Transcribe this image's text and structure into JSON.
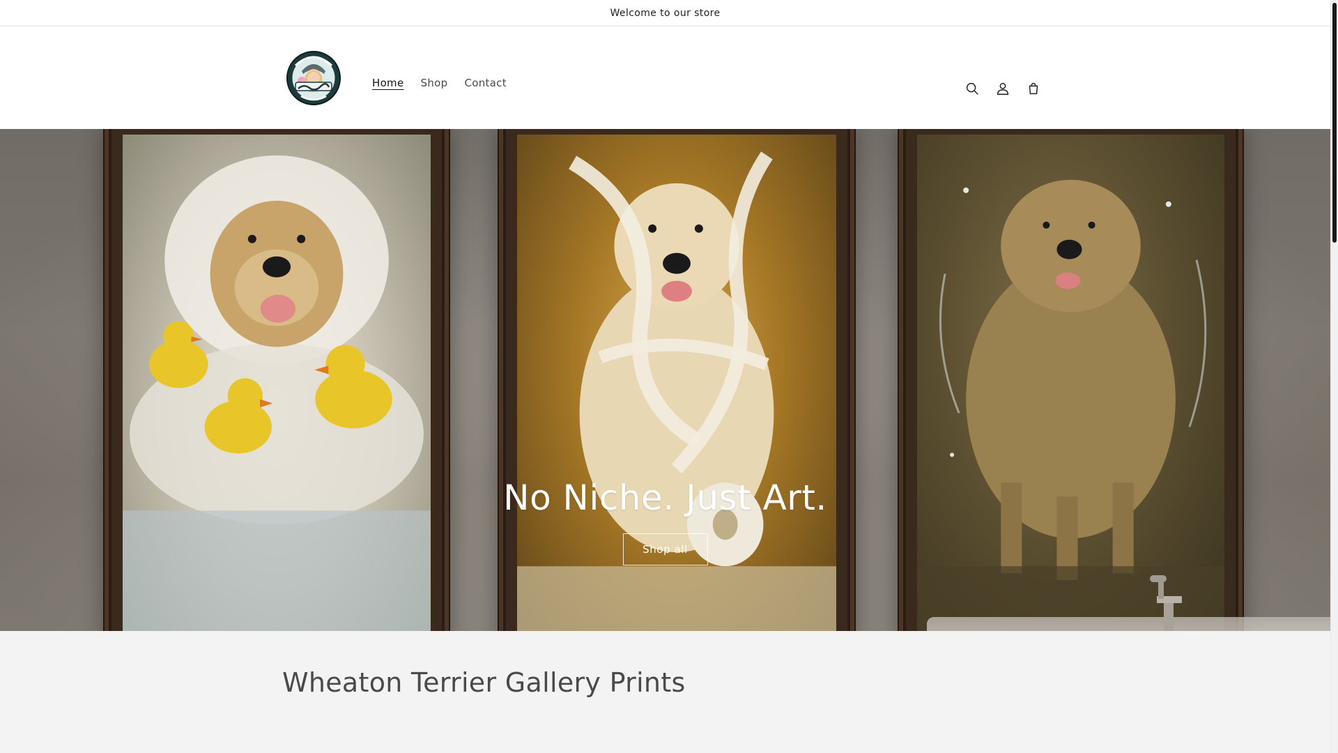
{
  "announcement": {
    "text": "Welcome to our store"
  },
  "header": {
    "logo_alt": "Hey Graphic Brittany Art",
    "nav": [
      {
        "label": "Home",
        "active": true
      },
      {
        "label": "Shop",
        "active": false
      },
      {
        "label": "Contact",
        "active": false
      }
    ],
    "icons": [
      "search-icon",
      "account-icon",
      "cart-icon"
    ]
  },
  "hero": {
    "title": "No Niche. Just Art.",
    "button_label": "Shop all"
  },
  "collection": {
    "title": "Wheaton Terrier Gallery Prints"
  },
  "colors": {
    "text": "#121212",
    "muted_text": "#4a4a4a",
    "section_bg": "#f3f3f3",
    "frame": "#3a2a1d"
  }
}
